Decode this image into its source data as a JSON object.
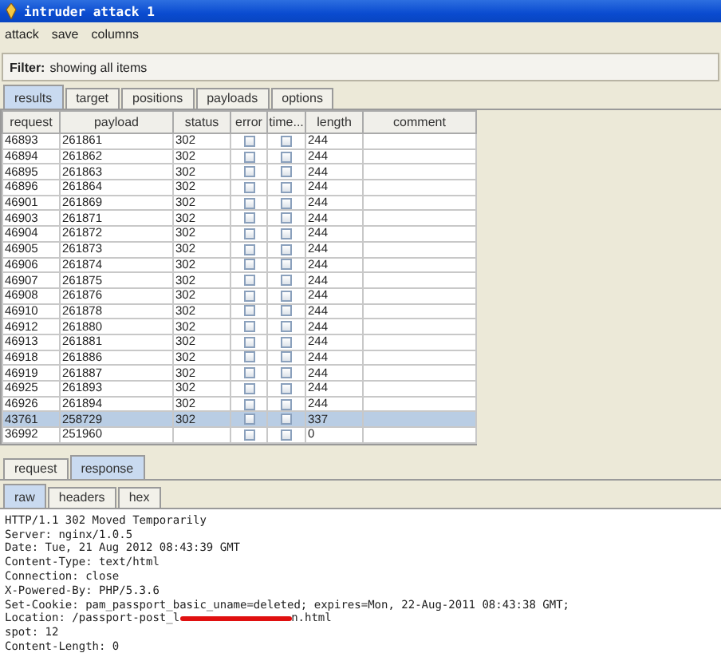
{
  "window": {
    "title": "intruder attack 1"
  },
  "menu": [
    "attack",
    "save",
    "columns"
  ],
  "filter": {
    "label": "Filter:",
    "value": "showing all items"
  },
  "tabs": [
    {
      "label": "results",
      "selected": true
    },
    {
      "label": "target",
      "selected": false
    },
    {
      "label": "positions",
      "selected": false
    },
    {
      "label": "payloads",
      "selected": false
    },
    {
      "label": "options",
      "selected": false
    }
  ],
  "table": {
    "columns": [
      "request",
      "payload",
      "status",
      "error",
      "time...",
      "length",
      "comment"
    ],
    "rows": [
      {
        "request": "46893",
        "payload": "261861",
        "status": "302",
        "error": false,
        "timeout": false,
        "length": "244",
        "selected": false
      },
      {
        "request": "46894",
        "payload": "261862",
        "status": "302",
        "error": false,
        "timeout": false,
        "length": "244",
        "selected": false
      },
      {
        "request": "46895",
        "payload": "261863",
        "status": "302",
        "error": false,
        "timeout": false,
        "length": "244",
        "selected": false
      },
      {
        "request": "46896",
        "payload": "261864",
        "status": "302",
        "error": false,
        "timeout": false,
        "length": "244",
        "selected": false
      },
      {
        "request": "46901",
        "payload": "261869",
        "status": "302",
        "error": false,
        "timeout": false,
        "length": "244",
        "selected": false
      },
      {
        "request": "46903",
        "payload": "261871",
        "status": "302",
        "error": false,
        "timeout": false,
        "length": "244",
        "selected": false
      },
      {
        "request": "46904",
        "payload": "261872",
        "status": "302",
        "error": false,
        "timeout": false,
        "length": "244",
        "selected": false
      },
      {
        "request": "46905",
        "payload": "261873",
        "status": "302",
        "error": false,
        "timeout": false,
        "length": "244",
        "selected": false
      },
      {
        "request": "46906",
        "payload": "261874",
        "status": "302",
        "error": false,
        "timeout": false,
        "length": "244",
        "selected": false
      },
      {
        "request": "46907",
        "payload": "261875",
        "status": "302",
        "error": false,
        "timeout": false,
        "length": "244",
        "selected": false
      },
      {
        "request": "46908",
        "payload": "261876",
        "status": "302",
        "error": false,
        "timeout": false,
        "length": "244",
        "selected": false
      },
      {
        "request": "46910",
        "payload": "261878",
        "status": "302",
        "error": false,
        "timeout": false,
        "length": "244",
        "selected": false
      },
      {
        "request": "46912",
        "payload": "261880",
        "status": "302",
        "error": false,
        "timeout": false,
        "length": "244",
        "selected": false
      },
      {
        "request": "46913",
        "payload": "261881",
        "status": "302",
        "error": false,
        "timeout": false,
        "length": "244",
        "selected": false
      },
      {
        "request": "46918",
        "payload": "261886",
        "status": "302",
        "error": false,
        "timeout": false,
        "length": "244",
        "selected": false
      },
      {
        "request": "46919",
        "payload": "261887",
        "status": "302",
        "error": false,
        "timeout": false,
        "length": "244",
        "selected": false
      },
      {
        "request": "46925",
        "payload": "261893",
        "status": "302",
        "error": false,
        "timeout": false,
        "length": "244",
        "selected": false
      },
      {
        "request": "46926",
        "payload": "261894",
        "status": "302",
        "error": false,
        "timeout": false,
        "length": "244",
        "selected": false
      },
      {
        "request": "43761",
        "payload": "258729",
        "status": "302",
        "error": false,
        "timeout": false,
        "length": "337",
        "selected": true
      },
      {
        "request": "36992",
        "payload": "251960",
        "error": false,
        "timeout": false,
        "length": "0",
        "selected": false
      }
    ]
  },
  "message_tabs": [
    {
      "label": "request",
      "selected": false
    },
    {
      "label": "response",
      "selected": true
    }
  ],
  "view_tabs": [
    {
      "label": "raw",
      "selected": true
    },
    {
      "label": "headers",
      "selected": false
    },
    {
      "label": "hex",
      "selected": false
    }
  ],
  "response_lines": [
    {
      "kind": "plain",
      "text": "HTTP/1.1 302 Moved Temporarily"
    },
    {
      "kind": "plain",
      "text": "Server: nginx/1.0.5"
    },
    {
      "kind": "plain",
      "text": "Date: Tue, 21 Aug 2012 08:43:39 GMT"
    },
    {
      "kind": "plain",
      "text": "Content-Type: text/html"
    },
    {
      "kind": "plain",
      "text": "Connection: close"
    },
    {
      "kind": "plain",
      "text": "X-Powered-By: PHP/5.3.6"
    },
    {
      "kind": "plain",
      "text": "Set-Cookie: pam_passport_basic_uname=deleted; expires=Mon, 22-Aug-2011 08:43:38 GMT;"
    },
    {
      "kind": "redacted",
      "text": "Location: /passport-post_l",
      "after": "n.html"
    },
    {
      "kind": "plain",
      "text": "spot: 12"
    },
    {
      "kind": "plain",
      "text": "Content-Length: 0"
    }
  ]
}
